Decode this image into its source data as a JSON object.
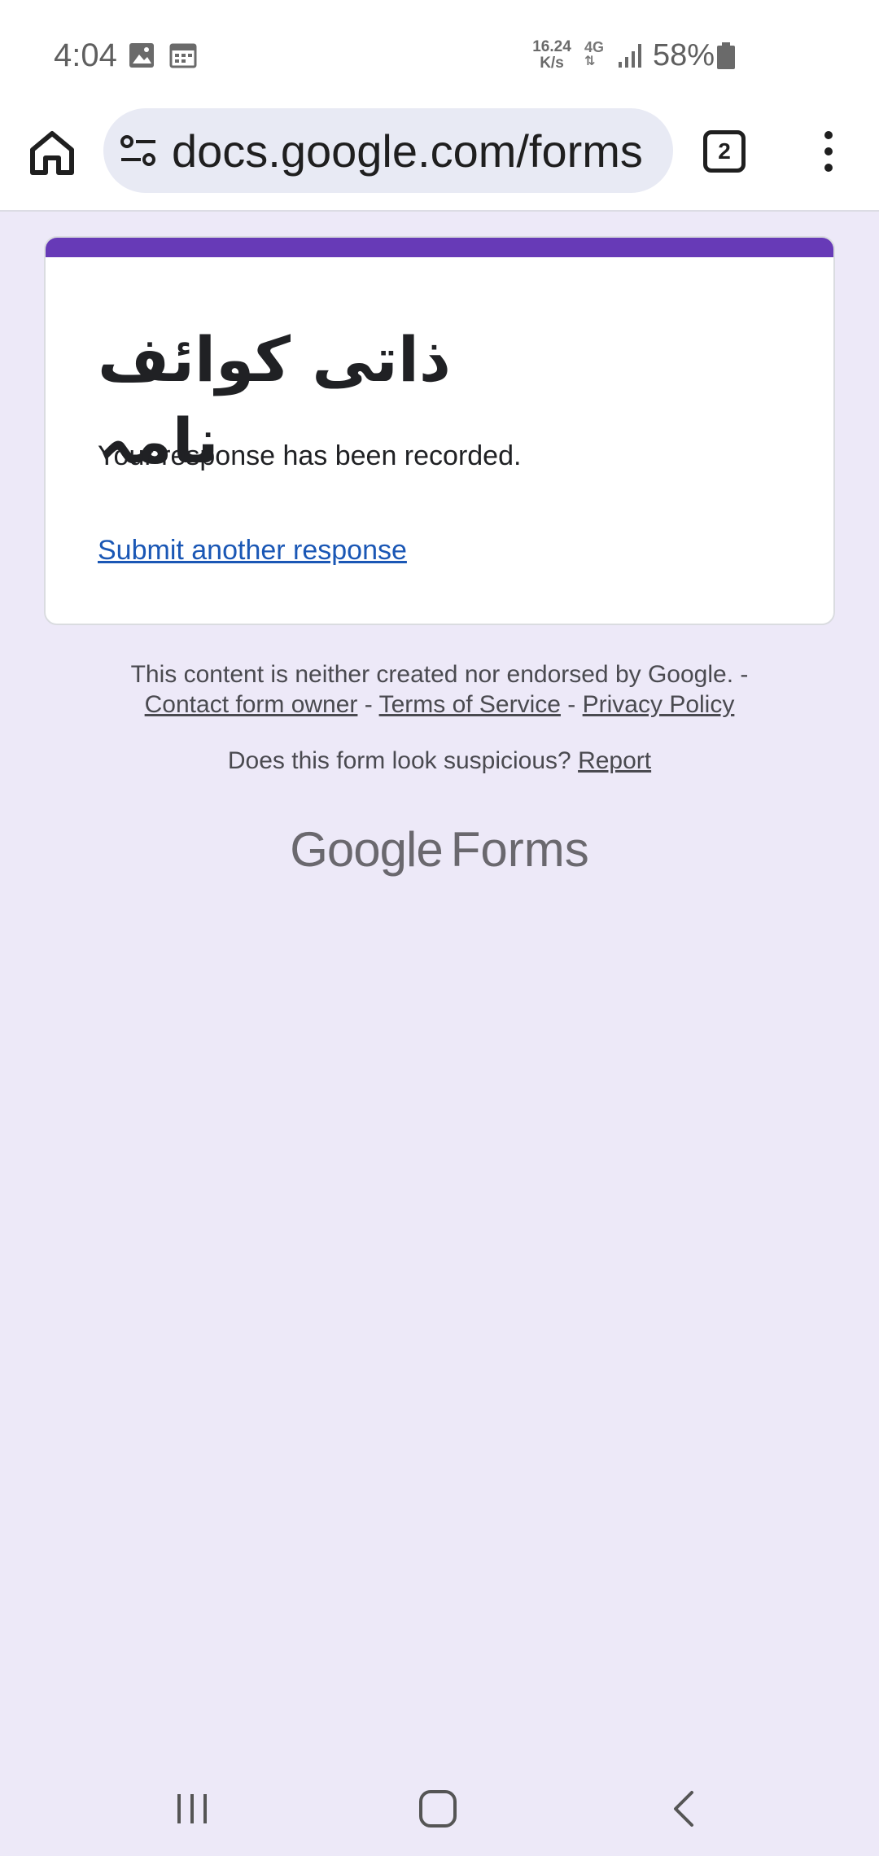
{
  "status_bar": {
    "time": "4:04",
    "net_speed_value": "16.24",
    "net_speed_unit": "K/s",
    "network_type": "4G",
    "battery": "58%",
    "icons": [
      "image-icon",
      "calendar-icon",
      "signal-icon",
      "battery-icon"
    ]
  },
  "browser": {
    "url": "docs.google.com/forms",
    "tab_count": "2",
    "icons": [
      "home-icon",
      "site-settings-icon",
      "tab-switcher-icon",
      "more-menu-icon"
    ]
  },
  "form": {
    "accent_color": "#673ab7",
    "title": "ذاتی کوائف نامہ",
    "confirmation": "Your response has been recorded.",
    "submit_another": "Submit another response"
  },
  "footer": {
    "disclaimer": "This content is neither created nor endorsed by Google. -",
    "contact_owner": "Contact form owner",
    "separator": "-",
    "terms": "Terms of Service",
    "privacy": "Privacy Policy",
    "suspicious_prompt": "Does this form look suspicious?",
    "report": "Report",
    "logo_google": "Google",
    "logo_forms": "Forms"
  },
  "nav_bar": {
    "icons": [
      "recent-apps-icon",
      "home-button-icon",
      "back-icon"
    ]
  }
}
